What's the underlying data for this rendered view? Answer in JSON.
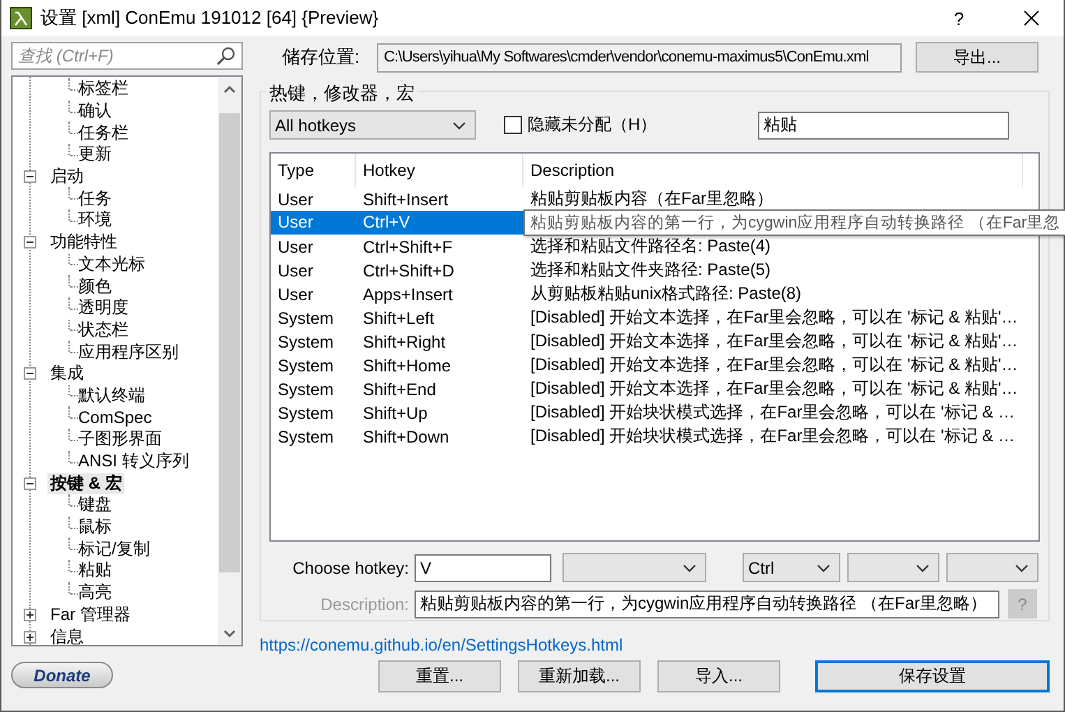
{
  "window": {
    "title": "设置 [xml] ConEmu 191012 [64] {Preview}",
    "help_button": "?"
  },
  "sidebar": {
    "search": {
      "placeholder": "查找 (Ctrl+F)"
    },
    "tree": {
      "leading_children": [
        {
          "label": "标签栏",
          "selected": false
        },
        {
          "label": "确认",
          "selected": false
        },
        {
          "label": "任务栏",
          "selected": false
        },
        {
          "label": "更新",
          "selected": false
        }
      ],
      "items": [
        {
          "label": "启动",
          "expanded": true,
          "selected": false,
          "children": [
            {
              "label": "任务",
              "selected": false
            },
            {
              "label": "环境",
              "selected": false
            }
          ]
        },
        {
          "label": "功能特性",
          "expanded": true,
          "selected": false,
          "children": [
            {
              "label": "文本光标",
              "selected": false
            },
            {
              "label": "颜色",
              "selected": false
            },
            {
              "label": "透明度",
              "selected": false
            },
            {
              "label": "状态栏",
              "selected": false
            },
            {
              "label": "应用程序区别",
              "selected": false
            }
          ]
        },
        {
          "label": "集成",
          "expanded": true,
          "selected": false,
          "children": [
            {
              "label": "默认终端",
              "selected": false
            },
            {
              "label": "ComSpec",
              "selected": false
            },
            {
              "label": "子图形界面",
              "selected": false
            },
            {
              "label": "ANSI 转义序列",
              "selected": false
            }
          ]
        },
        {
          "label": "按键 & 宏",
          "expanded": true,
          "selected": true,
          "children": [
            {
              "label": "键盘",
              "selected": false
            },
            {
              "label": "鼠标",
              "selected": false
            },
            {
              "label": "标记/复制",
              "selected": false
            },
            {
              "label": "粘贴",
              "selected": false
            },
            {
              "label": "高亮",
              "selected": false
            }
          ]
        },
        {
          "label": "Far 管理器",
          "expanded": false,
          "selected": false
        },
        {
          "label": "信息",
          "expanded": false,
          "selected": false
        }
      ]
    },
    "donate_button": "Donate"
  },
  "storage": {
    "label": "储存位置:",
    "path": "C:\\Users\\yihua\\My Softwares\\cmder\\vendor\\conemu-maximus5\\ConEmu.xml",
    "export_button": "导出..."
  },
  "hotkeys": {
    "title": "热键，修改器，宏",
    "filter": "All hotkeys",
    "hide_unassigned": {
      "label": "隐藏未分配（H）",
      "checked": false
    },
    "search": {
      "value": "粘贴"
    },
    "columns": [
      "Type",
      "Hotkey",
      "Description"
    ],
    "rows": [
      {
        "type": "User",
        "hotkey": "Shift+Insert",
        "description": "粘贴剪贴板内容（在Far里忽略）",
        "selected": false
      },
      {
        "type": "User",
        "hotkey": "Ctrl+V",
        "selected": true
      },
      {
        "type": "User",
        "hotkey": "Ctrl+Shift+F",
        "description": "选择和粘贴文件路径名: Paste(4)",
        "selected": false
      },
      {
        "type": "User",
        "hotkey": "Ctrl+Shift+D",
        "description": "选择和粘贴文件夹路径: Paste(5)",
        "selected": false
      },
      {
        "type": "User",
        "hotkey": "Apps+Insert",
        "description": "从剪贴板粘贴unix格式路径: Paste(8)",
        "selected": false
      },
      {
        "type": "System",
        "hotkey": "Shift+Left",
        "description": "[Disabled] 开始文本选择，在Far里会忽略，可以在 '标记 & 粘贴'…",
        "selected": false
      },
      {
        "type": "System",
        "hotkey": "Shift+Right",
        "description": "[Disabled] 开始文本选择，在Far里会忽略，可以在 '标记 & 粘贴'…",
        "selected": false
      },
      {
        "type": "System",
        "hotkey": "Shift+Home",
        "description": "[Disabled] 开始文本选择，在Far里会忽略，可以在 '标记 & 粘贴'…",
        "selected": false
      },
      {
        "type": "System",
        "hotkey": "Shift+End",
        "description": "[Disabled] 开始文本选择，在Far里会忽略，可以在 '标记 & 粘贴'…",
        "selected": false
      },
      {
        "type": "System",
        "hotkey": "Shift+Up",
        "description": "[Disabled] 开始块状模式选择，在Far里会忽略，可以在 '标记 & …",
        "selected": false
      },
      {
        "type": "System",
        "hotkey": "Shift+Down",
        "description": "[Disabled] 开始块状模式选择，在Far里会忽略，可以在 '标记 & …",
        "selected": false
      }
    ],
    "tooltip": "粘贴剪贴板内容的第一行，为cygwin应用程序自动转换路径 （在Far里忽",
    "choose_hotkey": {
      "label": "Choose hotkey:",
      "value": "V",
      "modifier": "Ctrl"
    },
    "description": {
      "label": "Description:",
      "disabled": true,
      "value": "粘贴剪贴板内容的第一行，为cygwin应用程序自动转换路径 （在Far里忽略）",
      "help_button": "?"
    }
  },
  "link": "https://conemu.github.io/en/SettingsHotkeys.html",
  "buttons": [
    {
      "label": "重置...",
      "default": false
    },
    {
      "label": "重新加载...",
      "default": false
    },
    {
      "label": "导入...",
      "default": false
    },
    {
      "label": "保存设置",
      "default": true
    }
  ]
}
